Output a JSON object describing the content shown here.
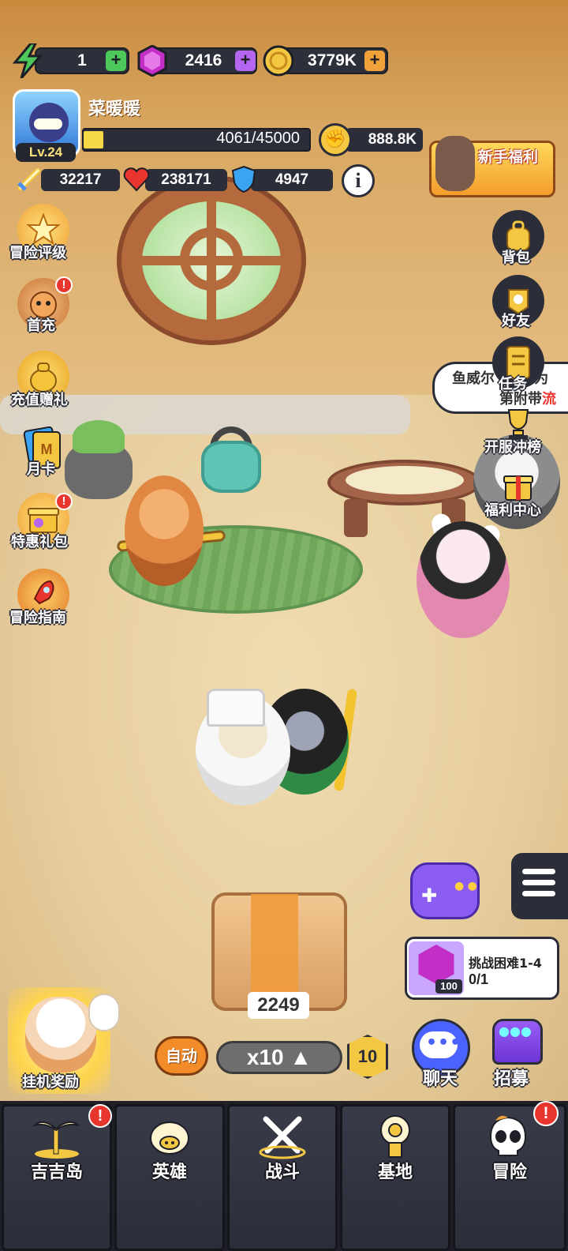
{
  "resources": {
    "energy": "1",
    "gems": "2416",
    "coins": "3779K",
    "plus_symbol": "+"
  },
  "player": {
    "name": "菜暖暖",
    "level": "Lv.24",
    "xp": "4061/45000",
    "xp_fraction": 0.09,
    "power": "888.8K"
  },
  "stats": {
    "attack": "32217",
    "hp": "238171",
    "defense": "4947",
    "info_symbol": "i"
  },
  "left_menu": [
    {
      "label": "冒险评级",
      "icon": "trophy-badge-icon"
    },
    {
      "label": "首充",
      "icon": "first-charge-icon",
      "badge": "!"
    },
    {
      "label": "充值赠礼",
      "icon": "money-bag-icon"
    },
    {
      "label": "月卡",
      "icon": "month-card-icon"
    },
    {
      "label": "特惠礼包",
      "icon": "gift-pack-icon",
      "badge": "!"
    },
    {
      "label": "冒险指南",
      "icon": "rocket-icon"
    }
  ],
  "newbie_welfare": {
    "label": "新手福利"
  },
  "right_menu": [
    {
      "label": "背包",
      "icon": "backpack-icon"
    },
    {
      "label": "好友",
      "icon": "friends-icon"
    },
    {
      "label": "任务",
      "icon": "task-scroll-icon"
    },
    {
      "label": "开服冲榜",
      "icon": "cup-icon"
    },
    {
      "label": "福利中心",
      "icon": "gift-box-icon"
    }
  ],
  "speech_bubble": {
    "line1": "鱼威尔",
    "line1b": "行为",
    "line2": "第附带",
    "line2_red": "流"
  },
  "box_count": "2249",
  "challenge": {
    "title": "挑战困难1-4",
    "progress": "0/1",
    "gem_count": "100"
  },
  "actions": {
    "auto": "自动",
    "multiplier": "x10 ▲",
    "level_badge": "10",
    "chat": "聊天",
    "recruit": "招募",
    "idle_reward": "挂机奖励"
  },
  "nav": [
    {
      "label": "吉吉岛",
      "icon": "palm-island-icon",
      "badge": "!"
    },
    {
      "label": "英雄",
      "icon": "hero-icon"
    },
    {
      "label": "战斗",
      "icon": "crossed-swords-icon"
    },
    {
      "label": "基地",
      "icon": "base-tower-icon"
    },
    {
      "label": "冒险",
      "icon": "skull-icon",
      "badge": "!"
    }
  ],
  "colors": {
    "hud_dark": "#2b2d39",
    "energy": "#4cc95a",
    "gem": "#c22ec6",
    "coin": "#f3c742",
    "alert": "#e8352d"
  }
}
